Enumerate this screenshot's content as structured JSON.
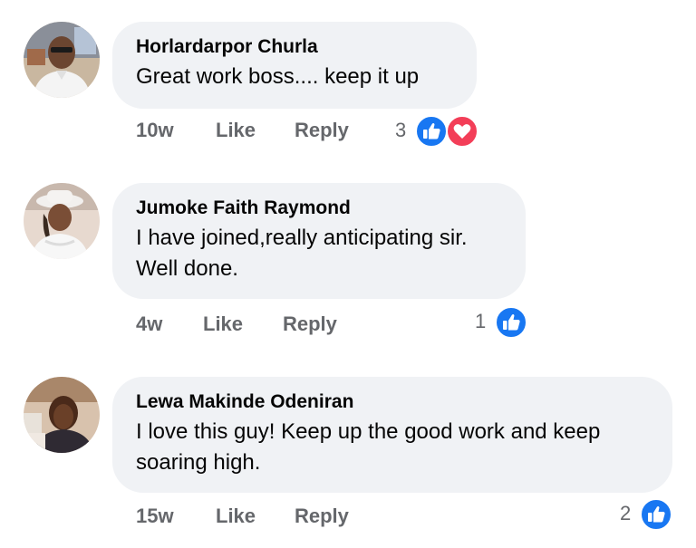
{
  "comments": [
    {
      "author": "Horlardarpor Churla",
      "text": "Great work boss.... keep it up",
      "time": "10w",
      "like_label": "Like",
      "reply_label": "Reply",
      "reaction_count": "3",
      "reactions": [
        "like-icon",
        "love-icon"
      ]
    },
    {
      "author": "Jumoke Faith Raymond",
      "text": "I have joined,really anticipating sir. Well done.",
      "time": "4w",
      "like_label": "Like",
      "reply_label": "Reply",
      "reaction_count": "1",
      "reactions": [
        "like-icon"
      ]
    },
    {
      "author": "Lewa Makinde Odeniran",
      "text": "I love this guy! Keep up the good work and keep soaring high.",
      "time": "15w",
      "like_label": "Like",
      "reply_label": "Reply",
      "reaction_count": "2",
      "reactions": [
        "like-icon"
      ]
    }
  ],
  "colors": {
    "bubble_bg": "#f0f2f5",
    "meta_text": "#65676b",
    "like_blue": "#1877f2",
    "love_red": "#f33e58"
  }
}
